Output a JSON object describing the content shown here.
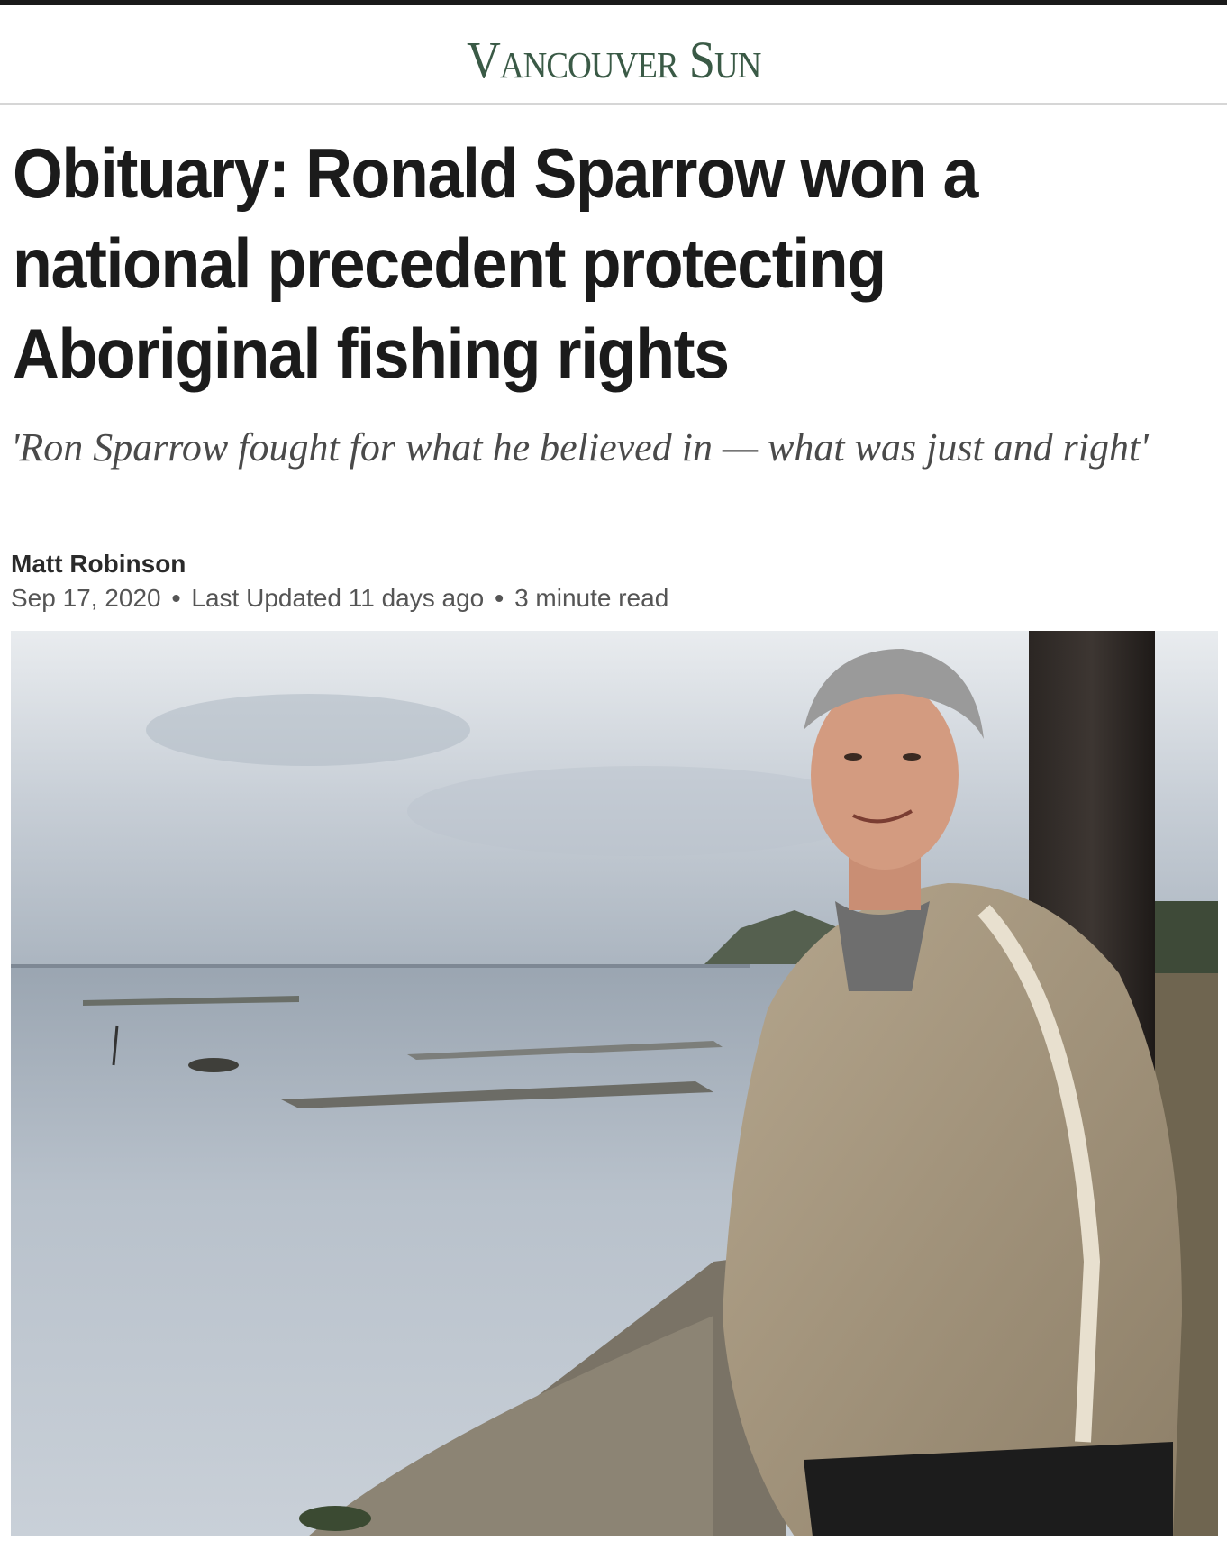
{
  "masthead": {
    "logo_text": "Vancouver Sun",
    "logo_color": "#3a5a46"
  },
  "article": {
    "headline": "Obituary: Ronald Sparrow won a national precedent protecting Aboriginal fishing rights",
    "deck": "'Ron Sparrow fought for what he believed in — what was just and right'",
    "author": "Matt Robinson",
    "date": "Sep 17, 2020",
    "updated": "Last Updated 11 days ago",
    "read_time": "3 minute read",
    "separator": "•"
  },
  "photo": {
    "subject": "man in tan jacket standing on shoreline beside wooden post"
  }
}
